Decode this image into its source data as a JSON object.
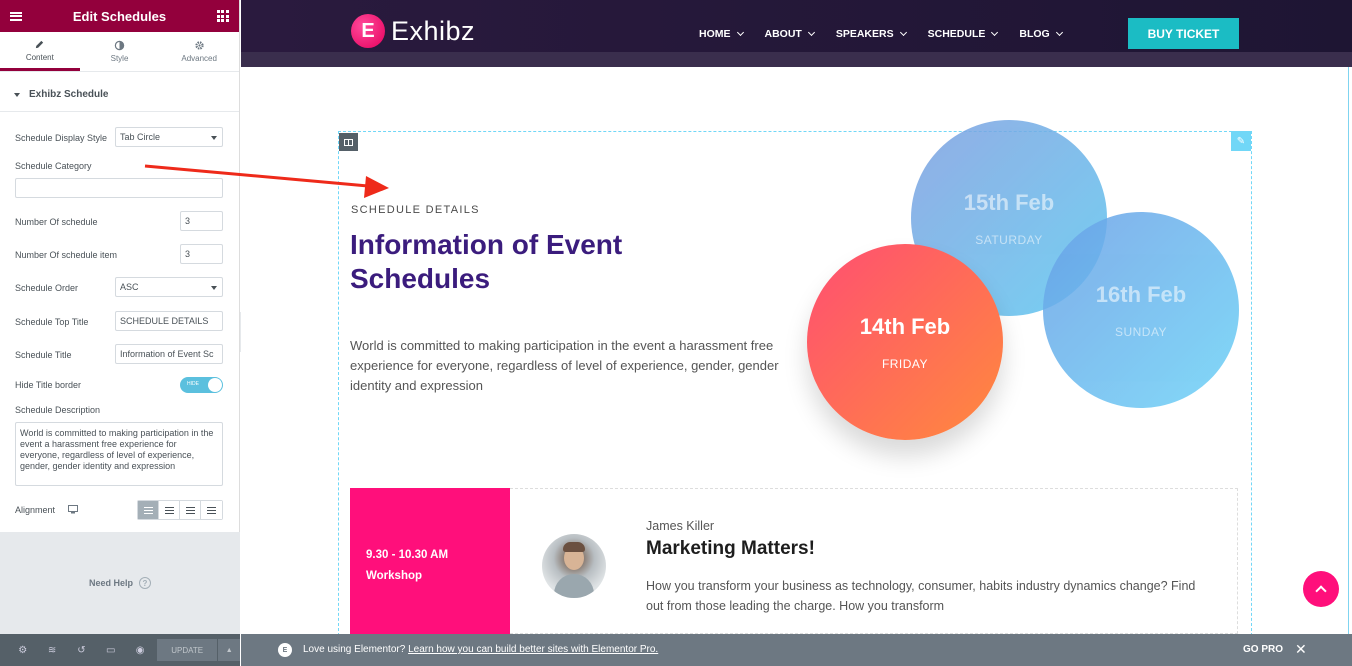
{
  "panel": {
    "title": "Edit Schedules",
    "tabs": [
      {
        "label": "Content",
        "icon": "pencil-icon",
        "active": true
      },
      {
        "label": "Style",
        "icon": "contrast-icon",
        "active": false
      },
      {
        "label": "Advanced",
        "icon": "gear-icon",
        "active": false
      }
    ],
    "section_title": "Exhibz Schedule",
    "controls": {
      "display_style_label": "Schedule Display Style",
      "display_style_value": "Tab Circle",
      "category_label": "Schedule Category",
      "category_value": "",
      "num_schedule_label": "Number Of schedule",
      "num_schedule_value": "3",
      "num_item_label": "Number Of schedule item",
      "num_item_value": "3",
      "order_label": "Schedule Order",
      "order_value": "ASC",
      "top_title_label": "Schedule Top Title",
      "top_title_value": "SCHEDULE DETAILS",
      "title_label": "Schedule Title",
      "title_value": "Information of Event Sc",
      "hide_border_label": "Hide Title border",
      "hide_border_toggle": "HIDE",
      "description_label": "Schedule Description",
      "description_value": "World is committed to making participation in the event a harassment free experience for everyone, regardless of level of experience, gender, gender identity and expression",
      "alignment_label": "Alignment",
      "alignment_selected": "left"
    },
    "need_help": "Need Help",
    "footer": {
      "update_label": "UPDATE"
    }
  },
  "site": {
    "logo_text": "Exhibz",
    "logo_mark": "E",
    "menu": [
      "HOME",
      "ABOUT",
      "SPEAKERS",
      "SCHEDULE",
      "BLOG"
    ],
    "buy_ticket": "BUY TICKET"
  },
  "schedule": {
    "top_title": "SCHEDULE DETAILS",
    "title": "Information of Event Schedules",
    "description": "World is committed to making participation in the event a harassment free experience for everyone, regardless of level of experience, gender, gender identity and expression",
    "days": [
      {
        "date": "14th Feb",
        "weekday": "FRIDAY",
        "active": true
      },
      {
        "date": "15th Feb",
        "weekday": "SATURDAY",
        "active": false
      },
      {
        "date": "16th Feb",
        "weekday": "SUNDAY",
        "active": false
      }
    ],
    "item": {
      "time": "9.30 - 10.30 AM",
      "type": "Workshop",
      "speaker": "James Killer",
      "title": "Marketing Matters!",
      "description": "How you transform your business as technology, consumer, habits industry dynamics change? Find out from those leading the charge. How you transform"
    }
  },
  "promo": {
    "prefix": "Love using Elementor?",
    "link": "Learn how you can build better sites with Elementor Pro.",
    "go_pro": "GO PRO"
  },
  "colors": {
    "panel_header": "#93003c",
    "accent_pink": "#ff0f7b",
    "title_purple": "#3b1c7d",
    "buy_teal": "#1bbcc4",
    "arrow_red": "#ee2a1a"
  }
}
